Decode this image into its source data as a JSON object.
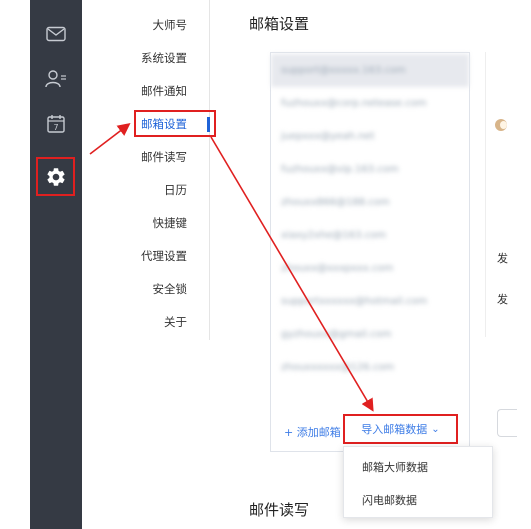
{
  "sidebar_icons": [
    "mail-icon",
    "contacts-icon",
    "calendar-icon",
    "settings-icon"
  ],
  "calendar_day": "7",
  "menu": {
    "items": [
      {
        "label": "大师号"
      },
      {
        "label": "系统设置"
      },
      {
        "label": "邮件通知"
      },
      {
        "label": "邮箱设置"
      },
      {
        "label": "邮件读写"
      },
      {
        "label": "日历"
      },
      {
        "label": "快捷键"
      },
      {
        "label": "代理设置"
      },
      {
        "label": "安全锁"
      },
      {
        "label": "关于"
      }
    ],
    "active": "邮箱设置"
  },
  "main": {
    "title": "邮箱设置",
    "accounts": [
      "support@xxxxx.163.com",
      "fuzhouxx@corp.netease.com",
      "juepxxx@yeah.net",
      "fuzhouxx@vip.163.com",
      "zhouxx866@188.com",
      "xiaxy2xhe@163.com",
      "zhouxx@xxxpxxx.com",
      "supportxxxxxx@hotmail.com",
      "gyzhouxx@gmail.com",
      "zhouxxxxxx@126.com"
    ],
    "add_mailbox_label": "+ 添加邮箱",
    "import_label": "导入邮箱数据",
    "import_caret": "⌄",
    "import_menu": [
      "邮箱大师数据",
      "闪电邮数据"
    ],
    "next_section_title": "邮件读写",
    "right_edge_labels": [
      "发",
      "发"
    ]
  }
}
